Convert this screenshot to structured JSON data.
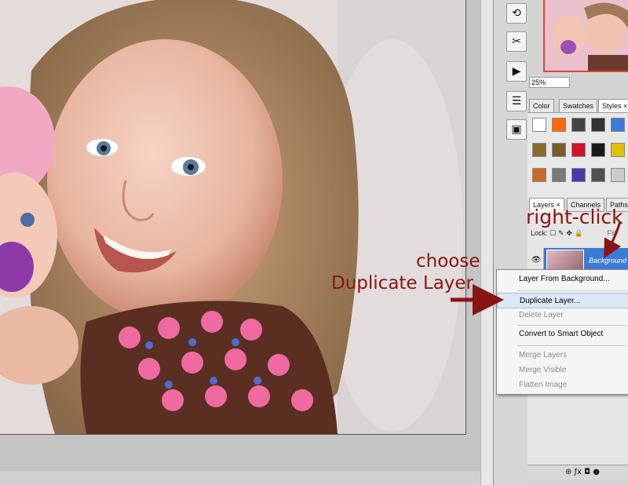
{
  "navigator": {
    "zoom": "25%"
  },
  "dock": {
    "icons": [
      "history-icon",
      "tools-icon",
      "actions-icon",
      "info-icon",
      "animation-icon"
    ]
  },
  "styles_panel": {
    "tabs": [
      {
        "label": "Color"
      },
      {
        "label": "Swatches"
      },
      {
        "label": "Styles ×"
      }
    ],
    "swatches": [
      "#ffffff",
      "#ff6a00",
      "#444444",
      "#333333",
      "#3a7bd5",
      "#8a6d2e",
      "#7a5c2a",
      "#d1122a",
      "#1a1a1a",
      "#e0c000",
      "#c86a2a",
      "#7a7a7a",
      "#4a3aa8",
      "#505050",
      "#cccccc"
    ]
  },
  "layers_panel": {
    "tabs": [
      {
        "label": "Layers ×"
      },
      {
        "label": "Channels"
      },
      {
        "label": "Paths"
      }
    ],
    "lock_label": "Lock:",
    "fill_label": "Fill",
    "layer_name": "Background",
    "footer_icons": "⊕ ƒx ◘ ●"
  },
  "context_menu": {
    "items": [
      {
        "label": "Layer From Background...",
        "disabled": false
      },
      {
        "label": "Duplicate Layer...",
        "disabled": false,
        "highlighted": true
      },
      {
        "label": "Delete Layer",
        "disabled": true
      },
      {
        "label": "Convert to Smart Object",
        "disabled": false
      },
      {
        "label": "Merge Layers",
        "disabled": true
      },
      {
        "label": "Merge Visible",
        "disabled": true
      },
      {
        "label": "Flatten Image",
        "disabled": true
      }
    ]
  },
  "annotations": {
    "right_click": "right-click",
    "choose": "choose",
    "duplicate_layer": "Duplicate Layer",
    "color": "#8a1414"
  }
}
